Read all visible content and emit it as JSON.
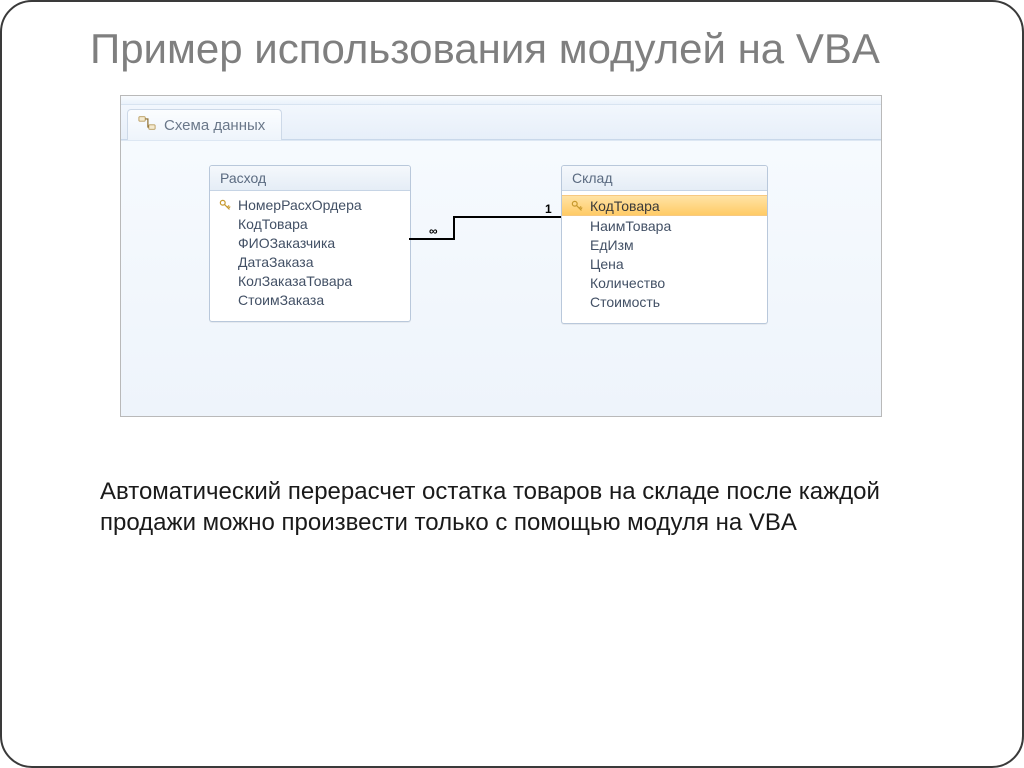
{
  "title": "Пример использования модулей на VBA",
  "access": {
    "tab_label": "Схема данных",
    "tables": {
      "left": {
        "name": "Расход",
        "fields": [
          {
            "label": "НомерРасхОрдера",
            "pk": true,
            "selected": false
          },
          {
            "label": "КодТовара",
            "pk": false,
            "selected": false
          },
          {
            "label": "ФИОЗаказчика",
            "pk": false,
            "selected": false
          },
          {
            "label": "ДатаЗаказа",
            "pk": false,
            "selected": false
          },
          {
            "label": "КолЗаказаТовара",
            "pk": false,
            "selected": false
          },
          {
            "label": "СтоимЗаказа",
            "pk": false,
            "selected": false
          }
        ]
      },
      "right": {
        "name": "Склад",
        "fields": [
          {
            "label": "КодТовара",
            "pk": true,
            "selected": true
          },
          {
            "label": "НаимТовара",
            "pk": false,
            "selected": false
          },
          {
            "label": "ЕдИзм",
            "pk": false,
            "selected": false
          },
          {
            "label": "Цена",
            "pk": false,
            "selected": false
          },
          {
            "label": "Количество",
            "pk": false,
            "selected": false
          },
          {
            "label": "Стоимость",
            "pk": false,
            "selected": false
          }
        ]
      }
    },
    "relation": {
      "left_label": "∞",
      "right_label": "1"
    }
  },
  "body_text": "Автоматический перерасчет остатка товаров на складе после каждой продажи можно произвести только с помощью модуля на VBA"
}
